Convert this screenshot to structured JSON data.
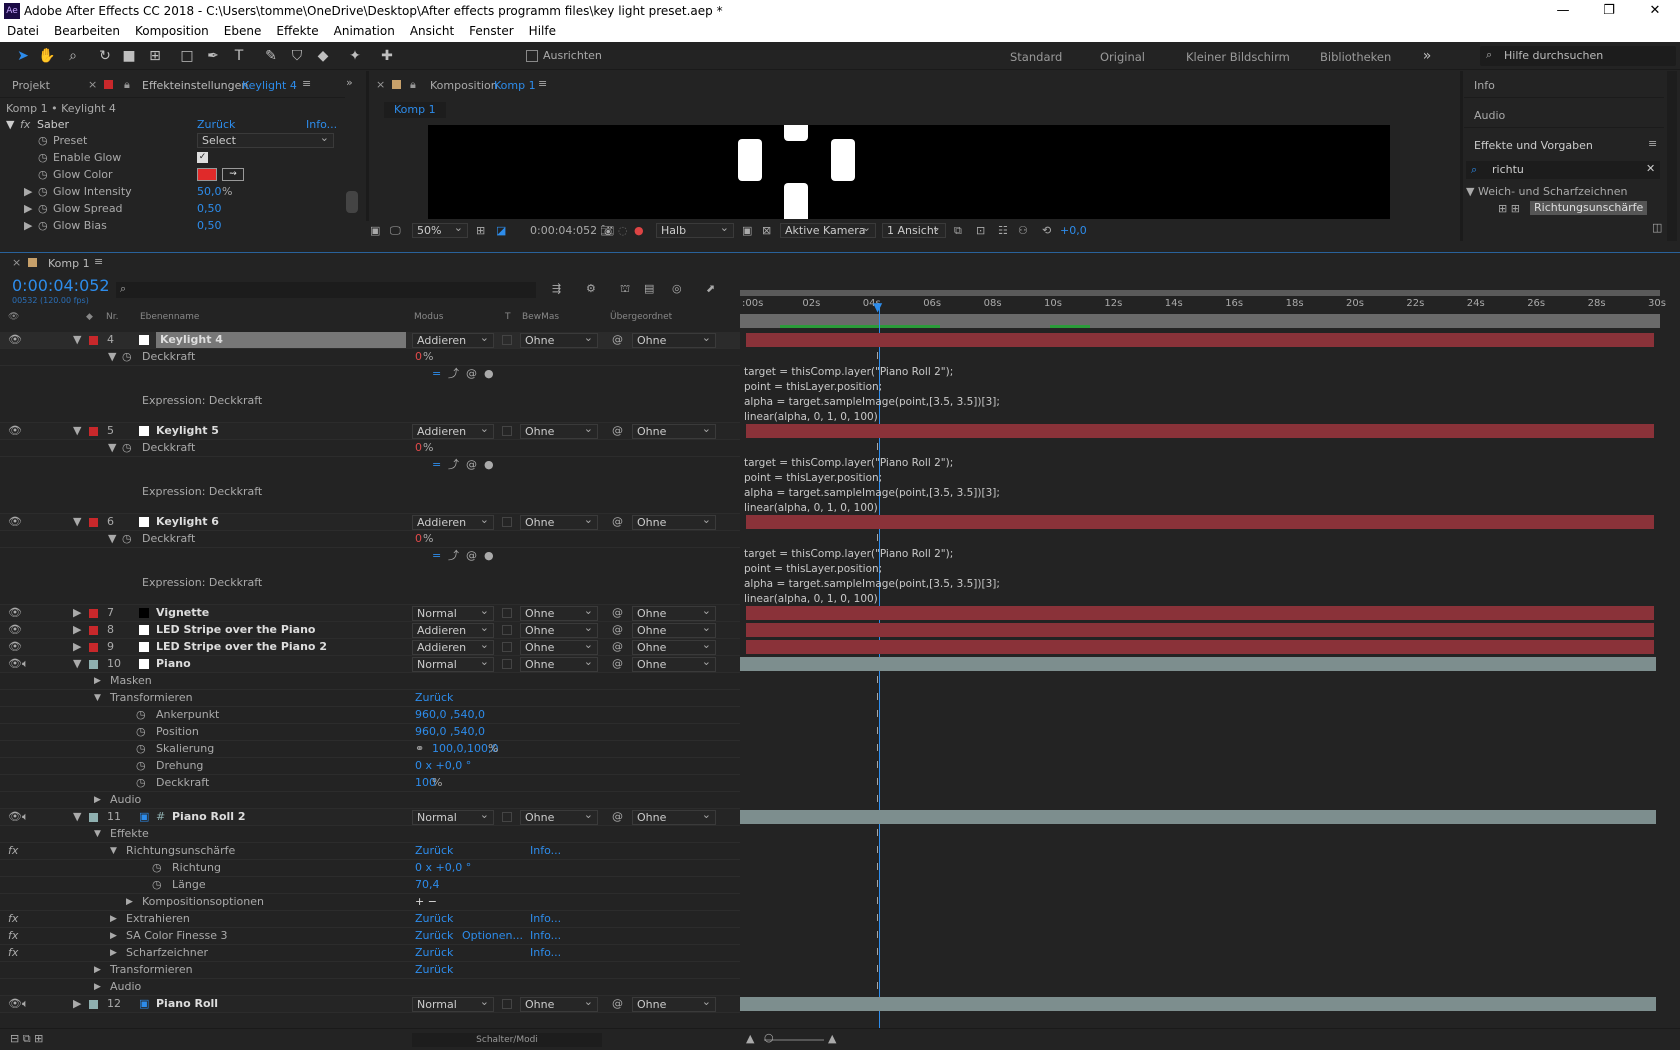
{
  "window": {
    "title": "Adobe After Effects CC 2018 - C:\\Users\\tomme\\OneDrive\\Desktop\\After effects programm files\\key light preset.aep *",
    "logo": "Ae"
  },
  "menu": [
    "Datei",
    "Bearbeiten",
    "Komposition",
    "Ebene",
    "Effekte",
    "Animation",
    "Ansicht",
    "Fenster",
    "Hilfe"
  ],
  "toolbar": {
    "align_label": "Ausrichten",
    "workspaces": [
      "Standard",
      "Original",
      "Kleiner Bildschirm",
      "Bibliotheken"
    ],
    "help_placeholder": "Hilfe durchsuchen"
  },
  "project_panel": {
    "tab_project": "Projekt",
    "tab_effects": "Effekteinstellungen",
    "tab_effects_layer": "Keylight 4",
    "subtitle": "Komp 1 • Keylight 4",
    "effect": {
      "name": "Saber",
      "reset": "Zurück",
      "info": "Info..."
    },
    "props": [
      {
        "name": "Preset",
        "value": "Select"
      },
      {
        "name": "Enable Glow",
        "value": ""
      },
      {
        "name": "Glow Color",
        "value": ""
      },
      {
        "name": "Glow Intensity",
        "value": "50,0",
        "unit": "%"
      },
      {
        "name": "Glow Spread",
        "value": "0,50"
      },
      {
        "name": "Glow Bias",
        "value": "0,50"
      }
    ],
    "glow_color": "#e02a2a"
  },
  "comp_panel": {
    "tab": "Komposition",
    "tab_comp": "Komp 1",
    "crumb": "Komp 1",
    "zoom": "50%",
    "time": "0:00:04:052",
    "resolution": "Halb",
    "camera": "Aktive Kamera",
    "views": "1 Ansicht",
    "exposure": "+0,0"
  },
  "right_panel": {
    "info": "Info",
    "audio": "Audio",
    "effects": "Effekte und Vorgaben",
    "search": "richtu",
    "category": "Weich- und Scharfzeichnen",
    "result": "Richtungsunschärfe"
  },
  "timeline": {
    "tab": "Komp 1",
    "timecode": "0:00:04:052",
    "fps": "00532 (120.00 fps)",
    "columns": {
      "nr": "Nr.",
      "name": "Ebenenname",
      "mode": "Modus",
      "t": "T",
      "trkmat": "BewMas",
      "parent": "Übergeordnet"
    },
    "ruler": [
      ":00s",
      "02s",
      "04s",
      "06s",
      "08s",
      "10s",
      "12s",
      "14s",
      "16s",
      "18s",
      "20s",
      "22s",
      "24s",
      "26s",
      "28s",
      "30s"
    ],
    "expression": "target = thisComp.layer(\"Piano Roll 2\");\npoint = thisLayer.position;\nalpha = target.sampleImage(point,[3.5, 3.5])[3];\nlinear(alpha, 0, 1, 0, 100)",
    "layers": [
      {
        "nr": "4",
        "name": "Keylight 4",
        "mode": "Addieren",
        "trk": "Ohne",
        "parent": "Ohne"
      },
      {
        "nr": "5",
        "name": "Keylight 5",
        "mode": "Addieren",
        "trk": "Ohne",
        "parent": "Ohne"
      },
      {
        "nr": "6",
        "name": "Keylight 6",
        "mode": "Addieren",
        "trk": "Ohne",
        "parent": "Ohne"
      },
      {
        "nr": "7",
        "name": "Vignette",
        "mode": "Normal",
        "trk": "Ohne",
        "parent": "Ohne"
      },
      {
        "nr": "8",
        "name": "LED Stripe over the Piano",
        "mode": "Addieren",
        "trk": "Ohne",
        "parent": "Ohne"
      },
      {
        "nr": "9",
        "name": "LED Stripe over the Piano 2",
        "mode": "Addieren",
        "trk": "Ohne",
        "parent": "Ohne"
      },
      {
        "nr": "10",
        "name": "Piano",
        "mode": "Normal",
        "trk": "Ohne",
        "parent": "Ohne"
      },
      {
        "nr": "11",
        "name": "Piano Roll 2",
        "mode": "Normal",
        "trk": "Ohne",
        "parent": "Ohne"
      },
      {
        "nr": "12",
        "name": "Piano Roll",
        "mode": "Normal",
        "trk": "Ohne",
        "parent": "Ohne"
      }
    ],
    "deckkraft": "Deckkraft",
    "deckkraft_val": "0",
    "pct": "%",
    "expr_label": "Expression: Deckkraft",
    "masken": "Masken",
    "transformieren": "Transformieren",
    "zurueck": "Zurück",
    "audio": "Audio",
    "ankerpunkt": "Ankerpunkt",
    "ank_val": "960,0 ,540,0",
    "position": "Position",
    "pos_val": "960,0 ,540,0",
    "skalierung": "Skalierung",
    "sk_val": "100,0,100,0",
    "drehung": "Drehung",
    "dr_val": "0 x +0,0 °",
    "deck_val": "100",
    "effekte": "Effekte",
    "richtung_fx": "Richtungsunschärfe",
    "info": "Info...",
    "richtung": "Richtung",
    "laenge": "Länge",
    "laenge_val": "70,4",
    "kompopt": "Kompositionsoptionen",
    "plusminus": "+ −",
    "extrahieren": "Extrahieren",
    "safinesse": "SA Color Finesse 3",
    "optionen": "Optionen...",
    "scharf": "Scharfzeichner",
    "footer": "Schalter/Modi"
  }
}
